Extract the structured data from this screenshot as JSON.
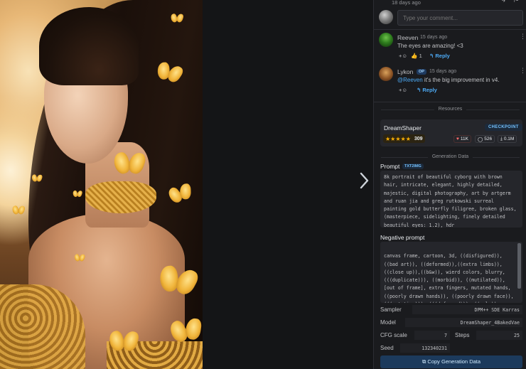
{
  "post": {
    "time_ago": "18 days ago"
  },
  "comment_input": {
    "placeholder": "Type your comment..."
  },
  "comments": [
    {
      "author": "Reeven",
      "time": "15 days ago",
      "text": "The eyes are amazing! <3",
      "reaction_emoji": "👍",
      "reaction_count": "1",
      "reply_label": "Reply"
    },
    {
      "author": "Lykon",
      "badge": "OP",
      "time": "15 days ago",
      "mention": "@Reeven",
      "text": " it's the big improvement in v4.",
      "reply_label": "Reply"
    }
  ],
  "resources": {
    "section_title": "Resources",
    "name": "DreamShaper",
    "type": "CHECKPOINT",
    "stars": "★★★★★",
    "rating_count": "309",
    "likes": "11K",
    "comments": "526",
    "downloads": "0.1M"
  },
  "generation": {
    "section_title": "Generation Data",
    "prompt_label": "Prompt",
    "prompt_badge": "TXT2IMG",
    "prompt": "8k portrait of beautiful cyborg with brown hair, intricate, elegant, highly detailed, majestic, digital photography, art by artgerm and ruan jia and greg rutkowski surreal painting gold butterfly filigree, broken glass, (masterpiece, sidelighting, finely detailed beautiful eyes: 1.2), hdr",
    "negative_label": "Negative prompt",
    "negative_prompt": "canvas frame, cartoon, 3d, ((disfigured)), ((bad art)), ((deformed)),((extra limbs)), ((close up)),((b&w)), wierd colors, blurry, (((duplicate))), ((morbid)), ((mutilated)), [out of frame], extra fingers, mutated hands, ((poorly drawn hands)), ((poorly drawn face)), (((mutation))), (((deformed))), ((ugly)), blurry, ((bad anatomy)), (((bad",
    "sampler_label": "Sampler",
    "sampler": "DPM++ SDE Karras",
    "model_label": "Model",
    "model": "DreamShaper_4BakedVae",
    "cfg_label": "CFG scale",
    "cfg": "7",
    "steps_label": "Steps",
    "steps": "25",
    "seed_label": "Seed",
    "seed": "132340231",
    "copy_label": "Copy Generation Data"
  },
  "colors": {
    "accent_blue": "#4dabf7",
    "star_gold": "#fab005",
    "panel_bg": "#1a1b1e"
  }
}
